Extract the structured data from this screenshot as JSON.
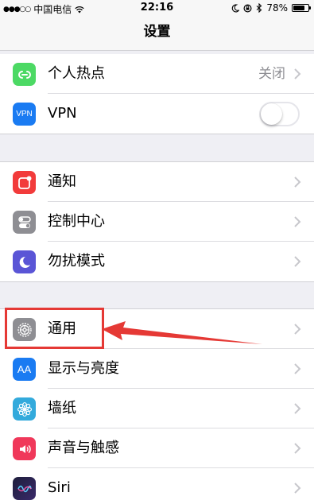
{
  "status_bar": {
    "signal": "●●●○○",
    "carrier": "中国电信",
    "time": "22:16",
    "battery_percent": "78%",
    "battery_level": 0.78
  },
  "nav": {
    "title": "设置"
  },
  "groups": [
    {
      "rows": [
        {
          "label": "个人热点",
          "value": "关闭",
          "icon": "personal-hotspot-icon",
          "color": "#4cd964"
        },
        {
          "label": "VPN",
          "icon_text": "VPN",
          "icon": "vpn-icon",
          "color": "#1a7bf2",
          "toggle_on": false
        }
      ]
    },
    {
      "rows": [
        {
          "label": "通知",
          "icon": "notifications-icon",
          "color": "#f23b3b"
        },
        {
          "label": "控制中心",
          "icon": "control-center-icon",
          "color": "#8e8e93"
        },
        {
          "label": "勿扰模式",
          "icon": "do-not-disturb-icon",
          "color": "#5a55d6"
        }
      ]
    },
    {
      "rows": [
        {
          "label": "通用",
          "icon": "gear-icon",
          "color": "#8e8e93"
        },
        {
          "label": "显示与亮度",
          "icon_text": "AA",
          "icon": "display-brightness-icon",
          "color": "#1a7bf2"
        },
        {
          "label": "墙纸",
          "icon": "wallpaper-icon",
          "color": "#33aadc"
        },
        {
          "label": "声音与触感",
          "icon": "sounds-icon",
          "color": "#f0385a"
        },
        {
          "label": "Siri",
          "icon": "siri-icon",
          "color": "#1e1e3c"
        }
      ]
    }
  ],
  "colors": {
    "accent_annotation": "#e53935",
    "background": "#efeff4"
  }
}
